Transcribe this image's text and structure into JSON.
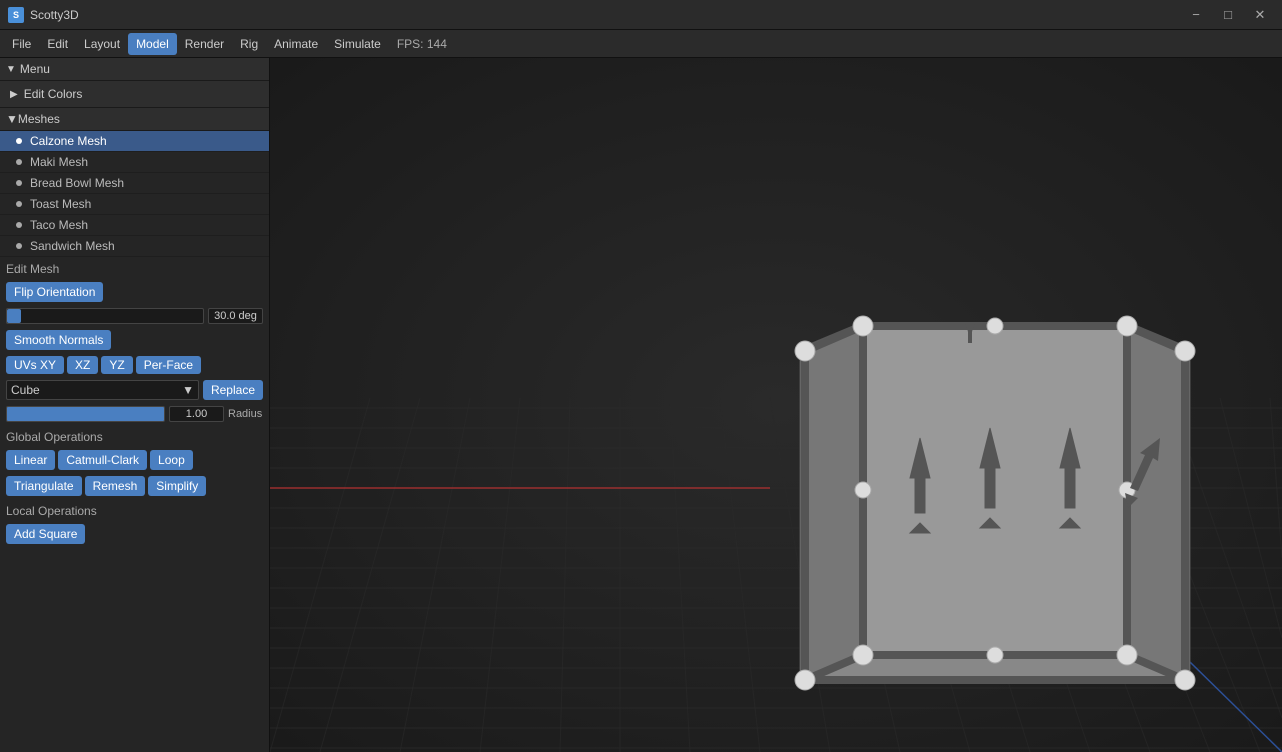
{
  "titlebar": {
    "app_name": "Scotty3D",
    "minimize": "−",
    "maximize": "□",
    "close": "✕"
  },
  "menubar": {
    "items": [
      "File",
      "Edit",
      "Layout",
      "Model",
      "Render",
      "Rig",
      "Animate",
      "Simulate"
    ],
    "active_index": 3,
    "fps": "FPS: 144"
  },
  "sidebar": {
    "menu_label": "Menu",
    "edit_colors": "Edit Colors",
    "meshes_label": "Meshes",
    "meshes": [
      {
        "name": "Calzone Mesh",
        "active": true
      },
      {
        "name": "Maki Mesh",
        "active": false
      },
      {
        "name": "Bread Bowl Mesh",
        "active": false
      },
      {
        "name": "Toast Mesh",
        "active": false
      },
      {
        "name": "Taco Mesh",
        "active": false
      },
      {
        "name": "Sandwich Mesh",
        "active": false
      }
    ],
    "edit_mesh_label": "Edit Mesh",
    "flip_orientation": "Flip Orientation",
    "slider_value": "30.0 deg",
    "smooth_normals": "Smooth Normals",
    "uv_buttons": [
      "UVs XY",
      "XZ",
      "YZ",
      "Per-Face"
    ],
    "cube_label": "Cube",
    "replace_label": "Replace",
    "radius_value": "1.00",
    "radius_label": "Radius",
    "global_ops_label": "Global Operations",
    "global_ops_row1": [
      "Linear",
      "Catmull-Clark",
      "Loop"
    ],
    "global_ops_row2": [
      "Triangulate",
      "Remesh",
      "Simplify"
    ],
    "local_ops_label": "Local Operations",
    "add_square": "Add Square"
  },
  "viewport": {
    "background": "#1a1a1a"
  }
}
